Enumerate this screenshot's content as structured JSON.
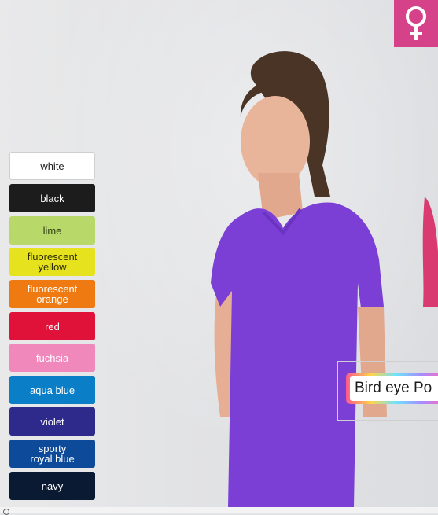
{
  "swatches": [
    {
      "label": "white",
      "color": "#ffffff"
    },
    {
      "label": "black",
      "color": "#1c1c1c"
    },
    {
      "label": "lime",
      "color": "#b9d86a"
    },
    {
      "label": "fluorescent yellow",
      "line1": "fluorescent",
      "line2": "yellow",
      "color": "#e6e21d"
    },
    {
      "label": "fluorescent orange",
      "line1": "fluorescent",
      "line2": "orange",
      "color": "#f07a12"
    },
    {
      "label": "red",
      "color": "#e01239"
    },
    {
      "label": "fuchsia",
      "color": "#f088bc"
    },
    {
      "label": "aqua blue",
      "color": "#0a7fc8"
    },
    {
      "label": "violet",
      "color": "#2d2a8c"
    },
    {
      "label": "sporty royal blue",
      "line1": "sporty",
      "line2": "royal blue",
      "color": "#0e4a9a"
    },
    {
      "label": "navy",
      "color": "#0b1a33"
    }
  ],
  "product": {
    "name": "Bird eye Po"
  },
  "badge": {
    "icon": "female-symbol-icon",
    "color": "#d6428a"
  },
  "model": {
    "shirt_color": "#7b3fd6"
  }
}
